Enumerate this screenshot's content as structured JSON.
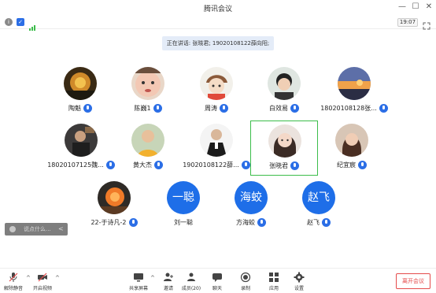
{
  "window": {
    "title": "腾讯会议",
    "minimize": "—",
    "maximize": "☐",
    "close": "✕"
  },
  "info": {
    "time": "19:07"
  },
  "speaking_banner": "正在讲话: 张晓君; 19020108122薛向阳;",
  "participants": [
    {
      "name": "陶魁"
    },
    {
      "name": "陈巍1"
    },
    {
      "name": "周涛"
    },
    {
      "name": "白效易"
    },
    {
      "name": "18020108128张..."
    },
    {
      "name": "18020107125魏..."
    },
    {
      "name": "黄大杰"
    },
    {
      "name": "19020108122薛..."
    },
    {
      "name": "张晓君"
    },
    {
      "name": "纪宜宸"
    },
    {
      "name": "22-于诗凡-2"
    },
    {
      "name": "刘一聪",
      "avatar_text": "一聪"
    },
    {
      "name": "方海蛟",
      "avatar_text": "海蛟"
    },
    {
      "name": "赵飞",
      "avatar_text": "赵飞"
    }
  ],
  "chat": {
    "placeholder": "说点什么...",
    "collapse": "<"
  },
  "toolbar": {
    "mute": "解除静音",
    "video": "开启视频",
    "share": "共享屏幕",
    "invite": "邀请",
    "members": "成员(20)",
    "chat": "聊天",
    "record": "录制",
    "apps": "应用",
    "settings": "设置",
    "leave": "离开会议",
    "caret": "^"
  },
  "colors": {
    "accent": "#1e6ee8",
    "active_border": "#3bbd4a",
    "leave": "#e54b4b"
  }
}
